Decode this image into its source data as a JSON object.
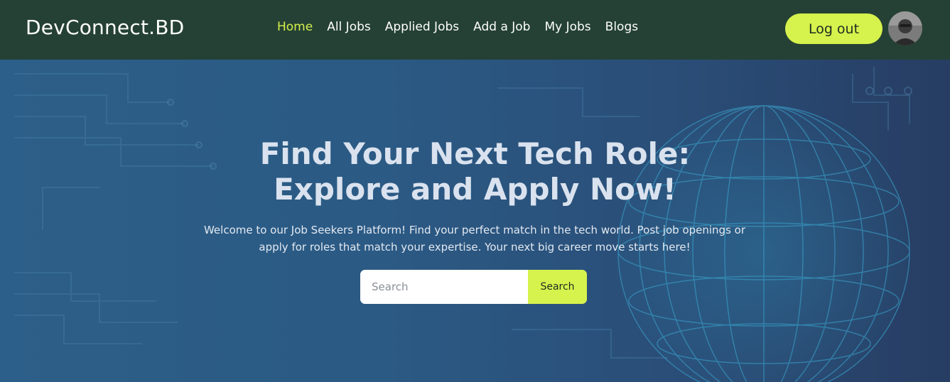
{
  "navbar": {
    "logo": "DevConnect.BD",
    "links": [
      {
        "label": "Home",
        "active": true
      },
      {
        "label": "All Jobs",
        "active": false
      },
      {
        "label": "Applied Jobs",
        "active": false
      },
      {
        "label": "Add a Job",
        "active": false
      },
      {
        "label": "My Jobs",
        "active": false
      },
      {
        "label": "Blogs",
        "active": false
      }
    ],
    "logout_label": "Log out",
    "avatar_icon": "user-avatar"
  },
  "hero": {
    "title_line1": "Find Your Next Tech Role:",
    "title_line2": "Explore and Apply Now!",
    "subtitle_line1": "Welcome to our Job Seekers Platform! Find your perfect match in the tech world. Post job openings or",
    "subtitle_line2": "apply for roles that match your expertise. Your next big career move starts here!",
    "search": {
      "placeholder": "Search",
      "value": "",
      "button_label": "Search"
    }
  },
  "colors": {
    "nav_bg": "#254135",
    "accent": "#d6f24c",
    "hero_bg": "#2b5a84"
  }
}
